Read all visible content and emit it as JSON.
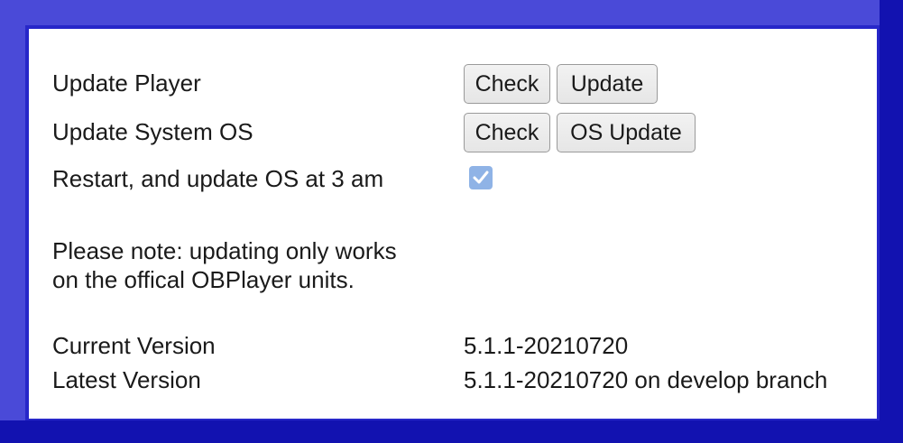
{
  "update_player": {
    "label": "Update Player",
    "check_label": "Check",
    "update_label": "Update"
  },
  "update_os": {
    "label": "Update System OS",
    "check_label": "Check",
    "update_label": "OS Update"
  },
  "restart": {
    "label": "Restart, and update OS at 3 am",
    "checked": true
  },
  "note": {
    "line1": "Please note: updating only works",
    "line2": "on the offical OBPlayer units."
  },
  "versions": {
    "current_label": "Current Version",
    "current_value": "5.1.1-20210720",
    "latest_label": "Latest Version",
    "latest_value": "5.1.1-20210720 on develop branch"
  },
  "colors": {
    "frame": "#2727c9",
    "checkbox": "#8fb3e6"
  }
}
